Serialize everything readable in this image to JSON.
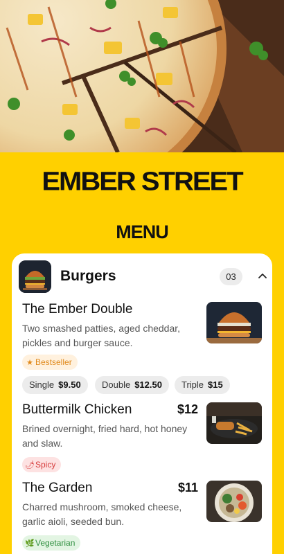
{
  "brand": {
    "name": "EMBER STREET"
  },
  "menu": {
    "title": "MENU"
  },
  "category": {
    "title": "Burgers",
    "count": "03",
    "thumb_icon": "burger-thumbnail",
    "toggle_icon": "chevron-up-icon"
  },
  "items": [
    {
      "name": "The Ember Double",
      "description": "Two smashed patties, aged cheddar, pickles and burger sauce.",
      "badge": {
        "icon": "star-icon",
        "glyph": "★",
        "label": "Bestseller"
      },
      "sizes": [
        {
          "label": "Single",
          "price": "$9.50"
        },
        {
          "label": "Double",
          "price": "$12.50"
        },
        {
          "label": "Triple",
          "price": "$15"
        }
      ]
    },
    {
      "name": "Buttermilk Chicken",
      "price": "$12",
      "description": "Brined overnight, fried hard, hot honey and slaw.",
      "badge": {
        "icon": "chili-icon",
        "glyph": "🌶",
        "label": "Spicy"
      }
    },
    {
      "name": "The Garden",
      "price": "$11",
      "description": "Charred mushroom, smoked cheese, garlic aioli, seeded bun.",
      "badge": {
        "icon": "leaf-icon",
        "glyph": "🌿",
        "label": "Vegetarian"
      }
    }
  ],
  "colors": {
    "background": "#FFD000",
    "card": "#FFFFFF",
    "bestseller": "#E08A1C",
    "spicy": "#D63A3A",
    "vegetarian": "#2F8F3F"
  }
}
